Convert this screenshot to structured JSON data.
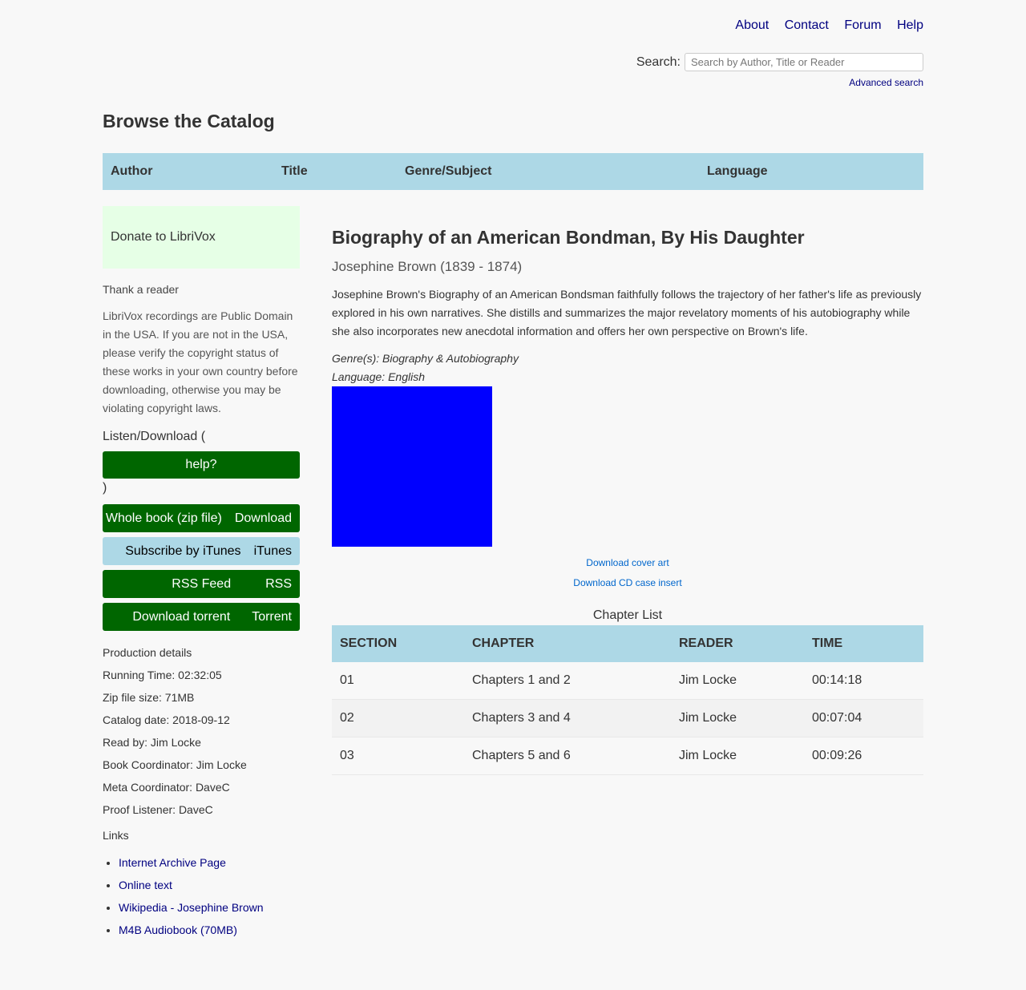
{
  "nav": {
    "links": [
      "About",
      "Contact",
      "Forum",
      "Help"
    ]
  },
  "search": {
    "label": "Search:",
    "placeholder": "Search by Author, Title or Reader",
    "advanced": "Advanced search"
  },
  "catalog": {
    "title": "Browse the Catalog",
    "tabs": [
      "Author",
      "Title",
      "Genre/Subject",
      "Language"
    ]
  },
  "sidebar": {
    "donate": "Donate to LibriVox",
    "thank": "Thank a reader",
    "pd_note": "LibriVox recordings are Public Domain in the USA. If you are not in the USA, please verify the copyright status of these works in your own country before downloading, otherwise you may be violating copyright laws.",
    "listen_label": "Listen/Download (",
    "help_button": "help?",
    "close_paren": ")",
    "downloads": [
      {
        "label": "Whole book (zip file)",
        "tag": "Download",
        "style": "green"
      },
      {
        "label": "Subscribe by iTunes",
        "tag": "iTunes",
        "style": "blue"
      },
      {
        "label": "RSS Feed",
        "tag": "RSS",
        "style": "green"
      },
      {
        "label": "Download torrent",
        "tag": "Torrent",
        "style": "green"
      }
    ],
    "production": [
      "Production details",
      "Running Time: 02:32:05",
      "Zip file size: 71MB",
      "Catalog date: 2018-09-12",
      "Read by: Jim Locke",
      "Book Coordinator: Jim Locke",
      "Meta Coordinator: DaveC",
      "Proof Listener: DaveC"
    ],
    "links_label": "Links",
    "links": [
      "Internet Archive Page",
      "Online text",
      "Wikipedia - Josephine Brown",
      "M4B Audiobook (70MB)"
    ]
  },
  "book": {
    "title": "Biography of an American Bondman, By His Daughter",
    "author": "Josephine Brown (1839 - 1874)",
    "description": "Josephine Brown's Biography of an American Bondsman faithfully follows the trajectory of her father's life as previously explored in his own narratives. She distills and summarizes the major revelatory moments of his autobiography while she also incorporates new anecdotal information and offers her own perspective on Brown's life.",
    "genres": "Genre(s): Biography & Autobiography",
    "language": "Language: English",
    "cover_color": "#0000ff",
    "cover_links": [
      "Download cover art",
      "Download CD case insert"
    ]
  },
  "chapters": {
    "caption": "Chapter List",
    "headers": [
      "SECTION",
      "CHAPTER",
      "READER",
      "TIME"
    ],
    "rows": [
      [
        "01",
        "Chapters 1 and 2",
        "Jim Locke",
        "00:14:18"
      ],
      [
        "02",
        "Chapters 3 and 4",
        "Jim Locke",
        "00:07:04"
      ],
      [
        "03",
        "Chapters 5 and 6",
        "Jim Locke",
        "00:09:26"
      ]
    ]
  },
  "colors": {
    "header_bar": "#add8e6",
    "donate_bg": "#e6ffe6",
    "button_green": "#006600",
    "link": "#000080"
  }
}
